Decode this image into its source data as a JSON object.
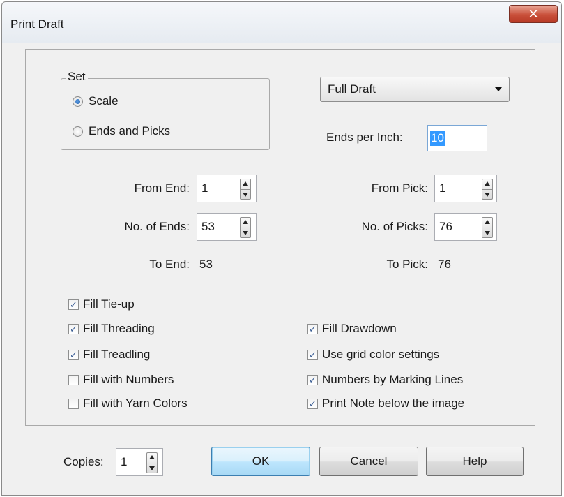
{
  "window": {
    "title": "Print Draft",
    "close_icon": "close-icon"
  },
  "set_group": {
    "legend": "Set",
    "options": [
      {
        "label": "Scale",
        "checked": true
      },
      {
        "label": "Ends and Picks",
        "checked": false
      }
    ]
  },
  "draft_select": {
    "value": "Full Draft"
  },
  "ends_per_inch": {
    "label": "Ends per Inch:",
    "value": "10"
  },
  "ends": {
    "from_label": "From End:",
    "from_value": "1",
    "count_label": "No. of Ends:",
    "count_value": "53",
    "to_label": "To End:",
    "to_value": "53"
  },
  "picks": {
    "from_label": "From Pick:",
    "from_value": "1",
    "count_label": "No. of Picks:",
    "count_value": "76",
    "to_label": "To Pick:",
    "to_value": "76"
  },
  "checkboxes_left": [
    {
      "label": "Fill Tie-up",
      "checked": true
    },
    {
      "label": "Fill Threading",
      "checked": true
    },
    {
      "label": "Fill Treadling",
      "checked": true
    },
    {
      "label": "Fill with Numbers",
      "checked": false
    },
    {
      "label": "Fill with Yarn Colors",
      "checked": false
    }
  ],
  "checkboxes_right": [
    {
      "label": "Fill Drawdown",
      "checked": true
    },
    {
      "label": "Use grid color settings",
      "checked": true
    },
    {
      "label": "Numbers by Marking Lines",
      "checked": true
    },
    {
      "label": "Print Note below the image",
      "checked": true
    }
  ],
  "copies": {
    "label": "Copies:",
    "value": "1"
  },
  "buttons": {
    "ok": "OK",
    "cancel": "Cancel",
    "help": "Help"
  },
  "check_glyph": "✓",
  "colors": {
    "accent": "#3399ff",
    "close": "#c9503a",
    "default_button": "#bee6fd"
  }
}
